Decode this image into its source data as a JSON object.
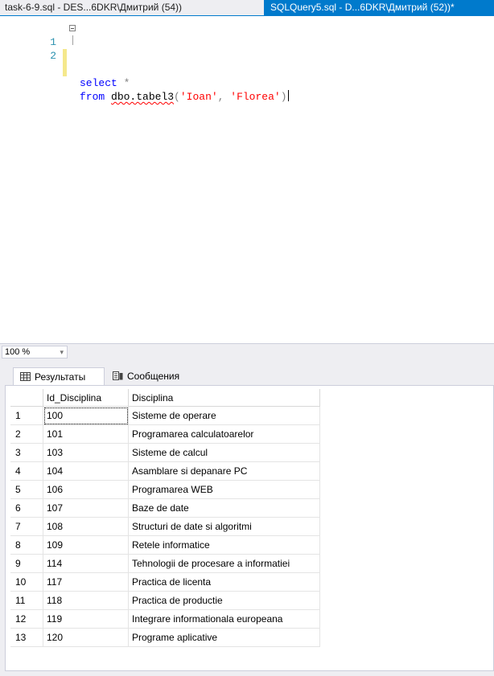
{
  "tabs": [
    {
      "label": "task-6-9.sql - DES...6DKR\\Дмитрий (54))",
      "active": false
    },
    {
      "label": "SQLQuery5.sql - D...6DKR\\Дмитрий (52))*",
      "active": true
    }
  ],
  "editor": {
    "lines": [
      {
        "number": "1",
        "kw1": "select",
        "rest": " *"
      },
      {
        "number": "2",
        "kw1": "from",
        "ident": "dbo.tabel3",
        "open": "(",
        "arg1": "'Ioan'",
        "comma": ", ",
        "arg2": "'Florea'",
        "close": ")"
      }
    ]
  },
  "zoom": {
    "value": "100 %",
    "arrow": "▾"
  },
  "result_tabs": [
    {
      "label": "Результаты",
      "icon": "grid-icon"
    },
    {
      "label": "Сообщения",
      "icon": "messages-icon"
    }
  ],
  "grid": {
    "columns": [
      "",
      "Id_Disciplina",
      "Disciplina"
    ],
    "rows": [
      [
        "1",
        "100",
        "Sisteme de operare"
      ],
      [
        "2",
        "101",
        "Programarea calculatoarelor"
      ],
      [
        "3",
        "103",
        "Sisteme de calcul"
      ],
      [
        "4",
        "104",
        "Asamblare si depanare PC"
      ],
      [
        "5",
        "106",
        "Programarea WEB"
      ],
      [
        "6",
        "107",
        "Baze de date"
      ],
      [
        "7",
        "108",
        "Structuri de date si algoritmi"
      ],
      [
        "8",
        "109",
        "Retele informatice"
      ],
      [
        "9",
        "114",
        "Tehnologii de procesare a informatiei"
      ],
      [
        "10",
        "117",
        "Practica de licenta"
      ],
      [
        "11",
        "118",
        "Practica de productie"
      ],
      [
        "12",
        "119",
        "Integrare informationala europeana"
      ],
      [
        "13",
        "120",
        "Programe aplicative"
      ]
    ]
  },
  "colors": {
    "active_tab": "#007acc",
    "keyword": "#0000ff",
    "string": "#ff0000",
    "line_number": "#2b91af"
  }
}
